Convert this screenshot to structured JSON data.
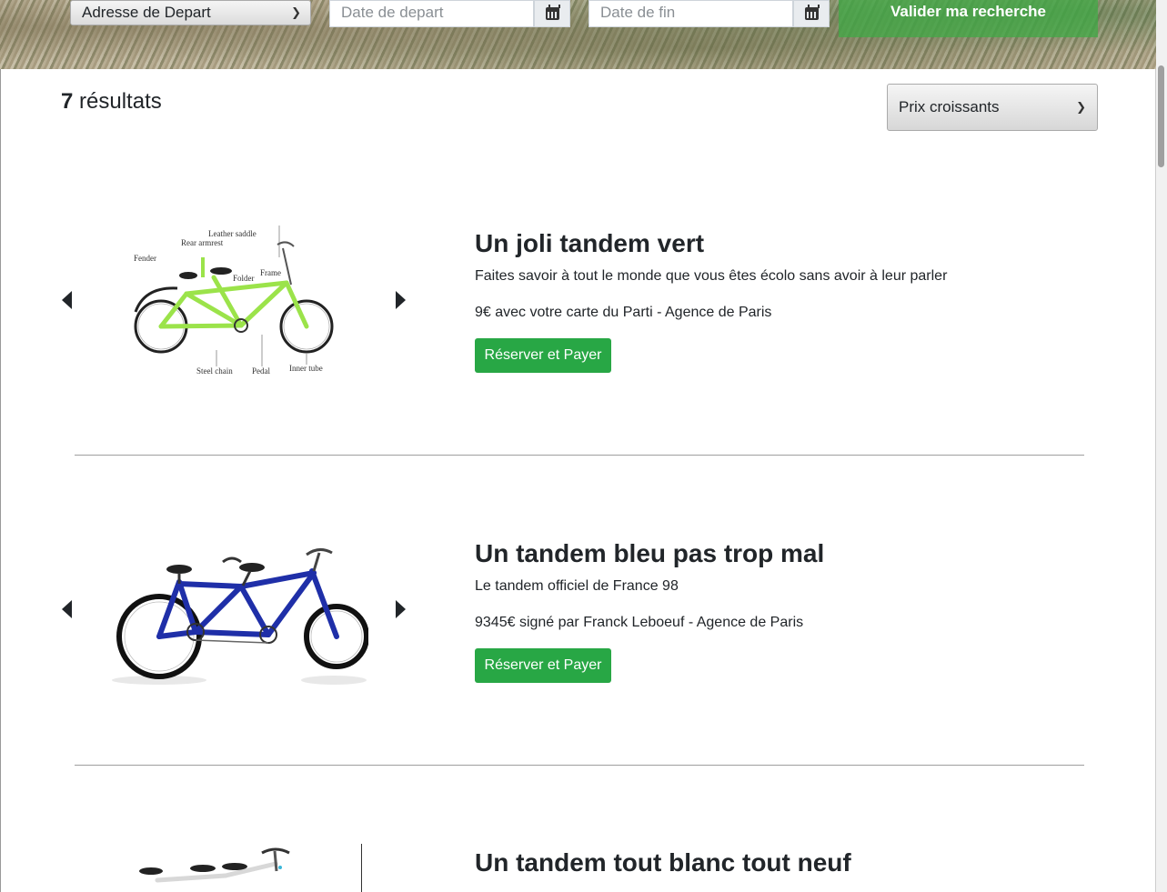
{
  "search": {
    "address_select": "Adresse de Depart",
    "start_date_placeholder": "Date de depart",
    "end_date_placeholder": "Date de fin",
    "submit_label": "Valider ma recherche"
  },
  "results": {
    "count": "7",
    "label": " résultats",
    "sort_selected": "Prix croissants"
  },
  "items": [
    {
      "title": "Un joli tandem vert",
      "description": "Faites savoir à tout le monde que vous êtes écolo sans avoir à leur parler",
      "price_line": "9€ avec votre carte du Parti - Agence de Paris",
      "button_label": "Réserver et Payer",
      "frame_color": "#9be34a",
      "diagram_labels": [
        "Leather saddle",
        "Rear armrest",
        "Fender",
        "Frame",
        "Folder",
        "Steel chain",
        "Pedal",
        "Inner tube"
      ]
    },
    {
      "title": "Un tandem bleu pas trop mal",
      "description": "Le tandem officiel de France 98",
      "price_line": "9345€ signé par Franck Leboeuf - Agence de Paris",
      "button_label": "Réserver et Payer",
      "frame_color": "#1f2fa8"
    },
    {
      "title": "Un tandem tout blanc tout neuf",
      "frame_color": "#e8e8e8"
    }
  ],
  "colors": {
    "accent_green": "#28a745",
    "submit_green": "#40aa46"
  },
  "icons": [
    "chevron-down-icon",
    "calendar-icon",
    "caret-left-icon",
    "caret-right-icon"
  ]
}
